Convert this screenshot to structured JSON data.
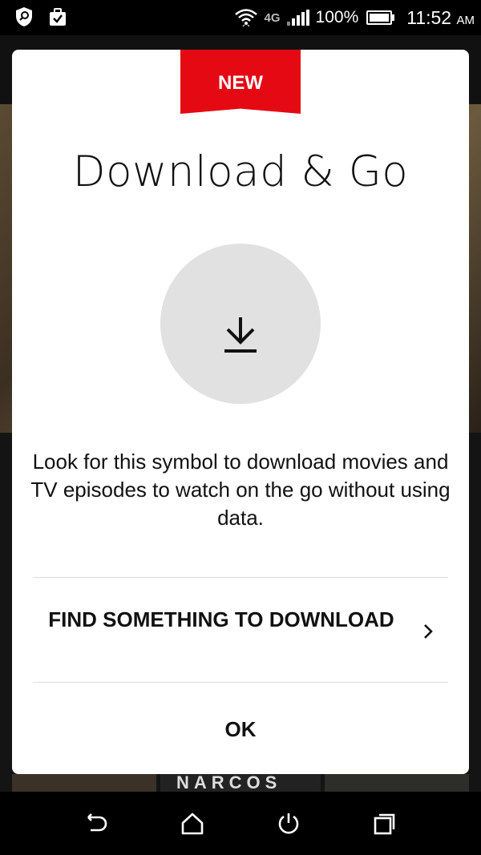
{
  "status_bar": {
    "network": "4G",
    "battery": "100%",
    "battery_level": 1.0,
    "time": "11:52",
    "ampm": "AM",
    "left_icons": [
      "shield-search-icon",
      "briefcase-check-icon"
    ]
  },
  "dialog": {
    "badge": "NEW",
    "title": "Download & Go",
    "icon": "download-icon",
    "message": "Look for this symbol to download movies and TV episodes to watch on the go without using data.",
    "find_button": "FIND SOMETHING TO DOWNLOAD",
    "ok_button": "OK"
  },
  "background": {
    "row_thumb_title": "NARCOS"
  },
  "nav_bar": {
    "buttons": [
      "back-icon",
      "home-icon",
      "power-icon",
      "recent-apps-icon"
    ]
  },
  "colors": {
    "accent": "#e50914",
    "circle": "#e1e1e1"
  }
}
